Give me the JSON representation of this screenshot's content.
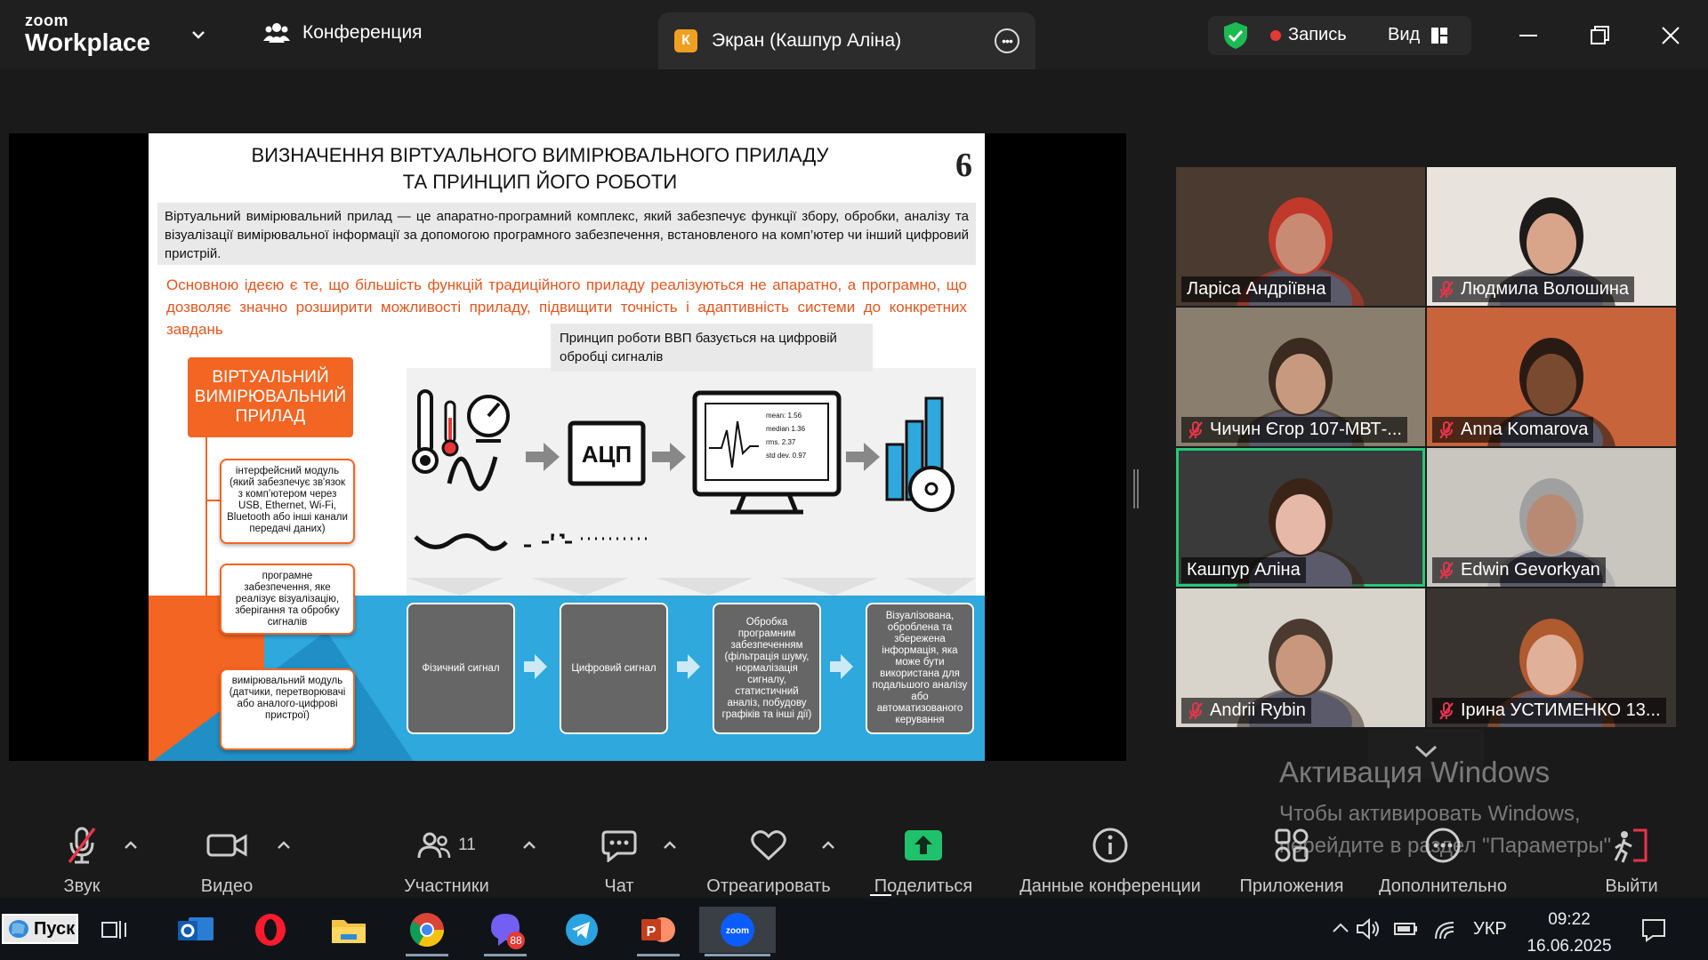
{
  "titlebar": {
    "logo_top": "zoom",
    "logo_bottom": "Workplace",
    "conference_tab": "Конференция",
    "screen_tab_badge": "К",
    "screen_tab": "Экран (Кашпур Аліна)",
    "record_label": "Запись",
    "view_label": "Вид"
  },
  "slide": {
    "title_line1": "ВИЗНАЧЕННЯ ВІРТУАЛЬНОГО ВИМІРЮВАЛЬНОГО ПРИЛАДУ",
    "title_line2": "ТА ПРИНЦИП ЙОГО РОБОТИ",
    "page_number": "6",
    "definition": "Віртуальний вимірювальний прилад — це апаратно-програмний комплекс, який забезпечує функції збору, обробки, аналізу та візуалізації вимірювальної інформації за допомогою програмного забезпечення, встановленого на комп’ютер чи інший цифровий пристрій.",
    "idea": "Основною ідеєю є те, що більшість функцій традиційного приладу реалізуються не апаратно, а програмно, що дозволяє значно розширити можливості приладу, підвищити точність і адаптивність системи до конкретних завдань",
    "principle": "Принцип роботи ВВП базується на цифровій обробці сигналів",
    "vvp_box": "ВІРТУАЛЬНИЙ ВИМІРЮВАЛЬНИЙ ПРИЛАД",
    "modules": [
      "інтерфейсний модуль (який забезпечує зв'язок з комп’ютером через USB, Ethernet, Wi-Fi, Bluetooth або інші канали передачі даних)",
      "програмне забезпечення, яке реалізує візуалізацію, зберігання та обробку сигналів",
      "вимірювальний модуль (датчики, перетворювачі або аналого-цифрові пристрої)"
    ],
    "adc_label": "АЦП",
    "monitor_stats": [
      "mean: 1.56",
      "median 1.36",
      "rms. 2.37",
      "std dev. 0.97"
    ],
    "flow": [
      "Фізичний сигнал",
      "Цифровий сигнал",
      "Обробка програмним забезпеченням (фільтрація шуму, нормалізація сигналу, статистичний аналіз, побудову графіків та інші дії)",
      "Візуалізована, оброблена та збережена інформація, яка може бути використана для подальшого аналізу або автоматизованого керування"
    ]
  },
  "participants": [
    {
      "name": "Ларіса Андріївна",
      "muted": false,
      "bg": "#4a3a30",
      "skin": "#c98a74",
      "hair": "#c0392b",
      "active": false
    },
    {
      "name": "Людмила Волошина",
      "muted": true,
      "bg": "#e8e3dc",
      "skin": "#d9a58a",
      "hair": "#1d1a1a",
      "active": false
    },
    {
      "name": "Чичин Єгор 107-МВТ-...",
      "muted": true,
      "bg": "#8a7e6e",
      "skin": "#c79a80",
      "hair": "#3a2a20",
      "active": false
    },
    {
      "name": "Anna Komarova",
      "muted": true,
      "bg": "#c8643c",
      "skin": "#7a4a30",
      "hair": "#2a1a14",
      "active": false
    },
    {
      "name": "Кашпур Аліна",
      "muted": false,
      "bg": "#3a3a3a",
      "skin": "#e6b8a8",
      "hair": "#3a2418",
      "active": true
    },
    {
      "name": "Edwin Gevorkyan",
      "muted": true,
      "bg": "#c9c6c0",
      "skin": "#b88a74",
      "hair": "#a0a0a0",
      "active": false
    },
    {
      "name": "Andrii Rybin",
      "muted": true,
      "bg": "#d8d4cc",
      "skin": "#c9967e",
      "hair": "#4a3a30",
      "active": false
    },
    {
      "name": "Ірина УСТИМЕНКО 13...",
      "muted": true,
      "bg": "#3a3430",
      "skin": "#e0b098",
      "hair": "#b05a30",
      "active": false
    }
  ],
  "watermark": {
    "title": "Активация Windows",
    "line1": "Чтобы активировать Windows,",
    "line2": "перейдите в раздел \"Параметры\""
  },
  "toolbar": {
    "audio": "Звук",
    "video": "Видео",
    "participants": "Участники",
    "participants_count": "11",
    "chat": "Чат",
    "react": "Отреагировать",
    "share": "Поделиться",
    "meeting_info": "Данные конференции",
    "apps": "Приложения",
    "more": "Дополнительно",
    "leave": "Выйти"
  },
  "taskbar": {
    "start": "Пуск",
    "viber_badge": "88",
    "zoom_label": "zoom",
    "language": "УКР",
    "time": "09:22",
    "date": "16.06.2025"
  },
  "colors": {
    "accent_green": "#22c97a",
    "slide_orange": "#f26522",
    "slide_blue": "#2ea8dd",
    "share_green": "#1fc26b",
    "leave_red": "#e8344a"
  }
}
